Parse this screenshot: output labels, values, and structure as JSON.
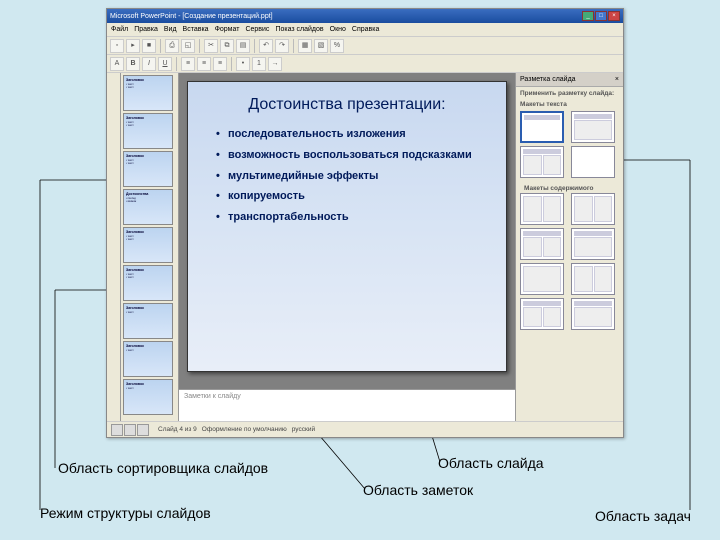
{
  "titlebar": {
    "text": "Microsoft PowerPoint - [Создание презентаций.ppt]"
  },
  "menu": [
    "Файл",
    "Правка",
    "Вид",
    "Вставка",
    "Формат",
    "Сервис",
    "Показ слайдов",
    "Окно",
    "Справка"
  ],
  "task": {
    "header": "Разметка слайда",
    "section1": "Применить разметку слайда:",
    "section2": "Макеты текста",
    "section3": "Макеты содержимого"
  },
  "notes": {
    "placeholder": "Заметки к слайду"
  },
  "status": {
    "slide": "Слайд 4 из 9",
    "design": "Оформление по умолчанию",
    "lang": "русский"
  },
  "slide": {
    "title": "Достоинства презентации:",
    "bullets": [
      "последовательность изложения",
      "возможность воспользоваться подсказками",
      "мультимедийные эффекты",
      "копируемость",
      "транспортабельность"
    ]
  },
  "callouts": {
    "sorter": "Область сортировщика слайдов",
    "outline": "Режим структуры слайдов",
    "slide": "Область слайда",
    "notes": "Область заметок",
    "task": "Область задач"
  }
}
